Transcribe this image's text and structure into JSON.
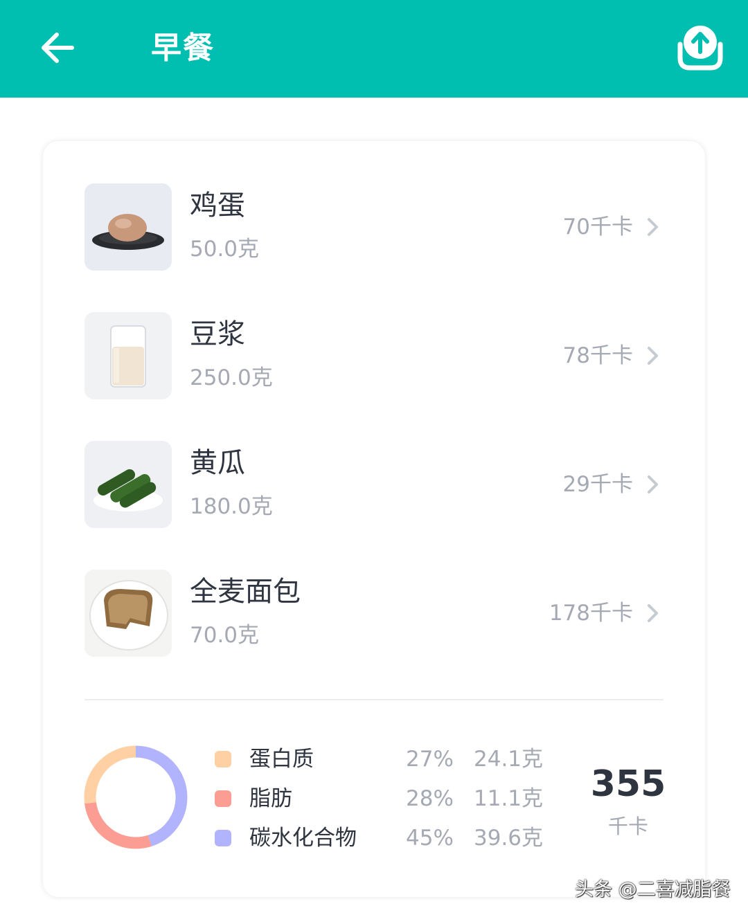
{
  "header": {
    "title": "早餐",
    "back_icon": "arrow-left-icon",
    "share_icon": "upload-share-icon",
    "background_color": "#00bfb0"
  },
  "foods": [
    {
      "name": "鸡蛋",
      "weight": "50.0克",
      "calories": "70千卡",
      "image": "egg-on-plate"
    },
    {
      "name": "豆浆",
      "weight": "250.0克",
      "calories": "78千卡",
      "image": "soy-milk-glass"
    },
    {
      "name": "黄瓜",
      "weight": "180.0克",
      "calories": "29千卡",
      "image": "cucumbers-on-plate"
    },
    {
      "name": "全麦面包",
      "weight": "70.0克",
      "calories": "178千卡",
      "image": "whole-wheat-bread-slice"
    }
  ],
  "nutrition": {
    "items": [
      {
        "label": "蛋白质",
        "percent": "27%",
        "grams": "24.1克",
        "color": "#ffd0a3"
      },
      {
        "label": "脂肪",
        "percent": "28%",
        "grams": "11.1克",
        "color": "#fb9d93"
      },
      {
        "label": "碳水化合物",
        "percent": "45%",
        "grams": "39.6克",
        "color": "#b2b3fd"
      }
    ],
    "total_calories": "355",
    "total_unit": "千卡"
  },
  "watermark": "头条 @二喜减脂餐"
}
